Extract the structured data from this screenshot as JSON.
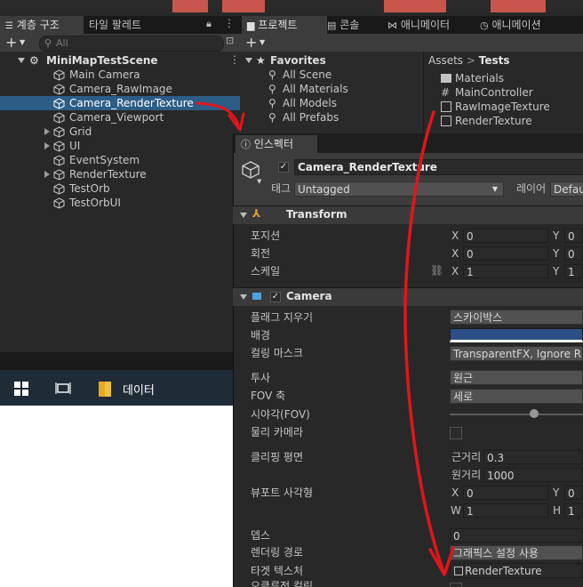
{
  "hierarchy": {
    "tabs": [
      {
        "label": "계층 구조"
      },
      {
        "label": "타일 팔레트"
      }
    ],
    "search_placeholder": "All",
    "scene_name": "MiniMapTestScene",
    "items": [
      {
        "label": "Main Camera"
      },
      {
        "label": "Camera_RawImage"
      },
      {
        "label": "Camera_RenderTexture"
      },
      {
        "label": "Camera_Viewport"
      },
      {
        "label": "Grid"
      },
      {
        "label": "UI"
      },
      {
        "label": "EventSystem"
      },
      {
        "label": "RenderTexture"
      },
      {
        "label": "TestOrb"
      },
      {
        "label": "TestOrbUI"
      }
    ]
  },
  "taskbar": {
    "folder_label": "데이터"
  },
  "project": {
    "tabs": [
      {
        "label": "프로젝트"
      },
      {
        "label": "콘솔"
      },
      {
        "label": "애니메이터"
      },
      {
        "label": "애니메이션"
      }
    ],
    "favorites_label": "Favorites",
    "favorites": [
      {
        "label": "All Scene"
      },
      {
        "label": "All Materials"
      },
      {
        "label": "All Models"
      },
      {
        "label": "All Prefabs"
      }
    ],
    "breadcrumb_root": "Assets",
    "breadcrumb_sep": ">",
    "breadcrumb_current": "Tests",
    "assets": [
      {
        "label": "Materials"
      },
      {
        "label": "MainController"
      },
      {
        "label": "RawImageTexture"
      },
      {
        "label": "RenderTexture"
      }
    ]
  },
  "inspector": {
    "tab_label": "인스펙터",
    "object_name": "Camera_RenderTexture",
    "tag_label": "태그",
    "tag_value": "Untagged",
    "layer_label": "레이어",
    "layer_value": "Defau",
    "transform": {
      "title": "Transform",
      "position_label": "포지션",
      "rotation_label": "회전",
      "scale_label": "스케일",
      "x_axis": "X",
      "y_axis": "Y",
      "position": {
        "x": "0",
        "y": "0"
      },
      "rotation": {
        "x": "0",
        "y": "0"
      },
      "scale": {
        "x": "1",
        "y": "1"
      }
    },
    "camera": {
      "title": "Camera",
      "clear_flags_label": "플래그 지우기",
      "clear_flags_value": "스카이박스",
      "background_label": "배경",
      "background_color": "#2b4f86",
      "culling_mask_label": "컬링 마스크",
      "culling_mask_value": "TransparentFX, Ignore R",
      "projection_label": "투사",
      "projection_value": "원근",
      "fov_axis_label": "FOV 축",
      "fov_axis_value": "세로",
      "fov_label": "시야각(FOV)",
      "physical_camera_label": "물리 카메라",
      "clipping_label": "클리핑 평면",
      "near_label": "근거리",
      "near_value": "0.3",
      "far_label": "원거리",
      "far_value": "1000",
      "viewport_label": "뷰포트 사각형",
      "vp_x_label": "X",
      "vp_y_label": "Y",
      "vp_w_label": "W",
      "vp_h_label": "H",
      "viewport": {
        "x": "0",
        "y": "0",
        "w": "1",
        "h": "1"
      },
      "depth_label": "뎁스",
      "depth_value": "0",
      "rendering_path_label": "렌더링 경로",
      "rendering_path_value": "그래픽스 설정 사용",
      "target_texture_label": "타겟 텍스처",
      "target_texture_value": "RenderTexture",
      "occlusion_label": "오클루전 컬링"
    }
  },
  "colors": {
    "selection": "#2c5d87",
    "annotation": "#e0161b"
  }
}
